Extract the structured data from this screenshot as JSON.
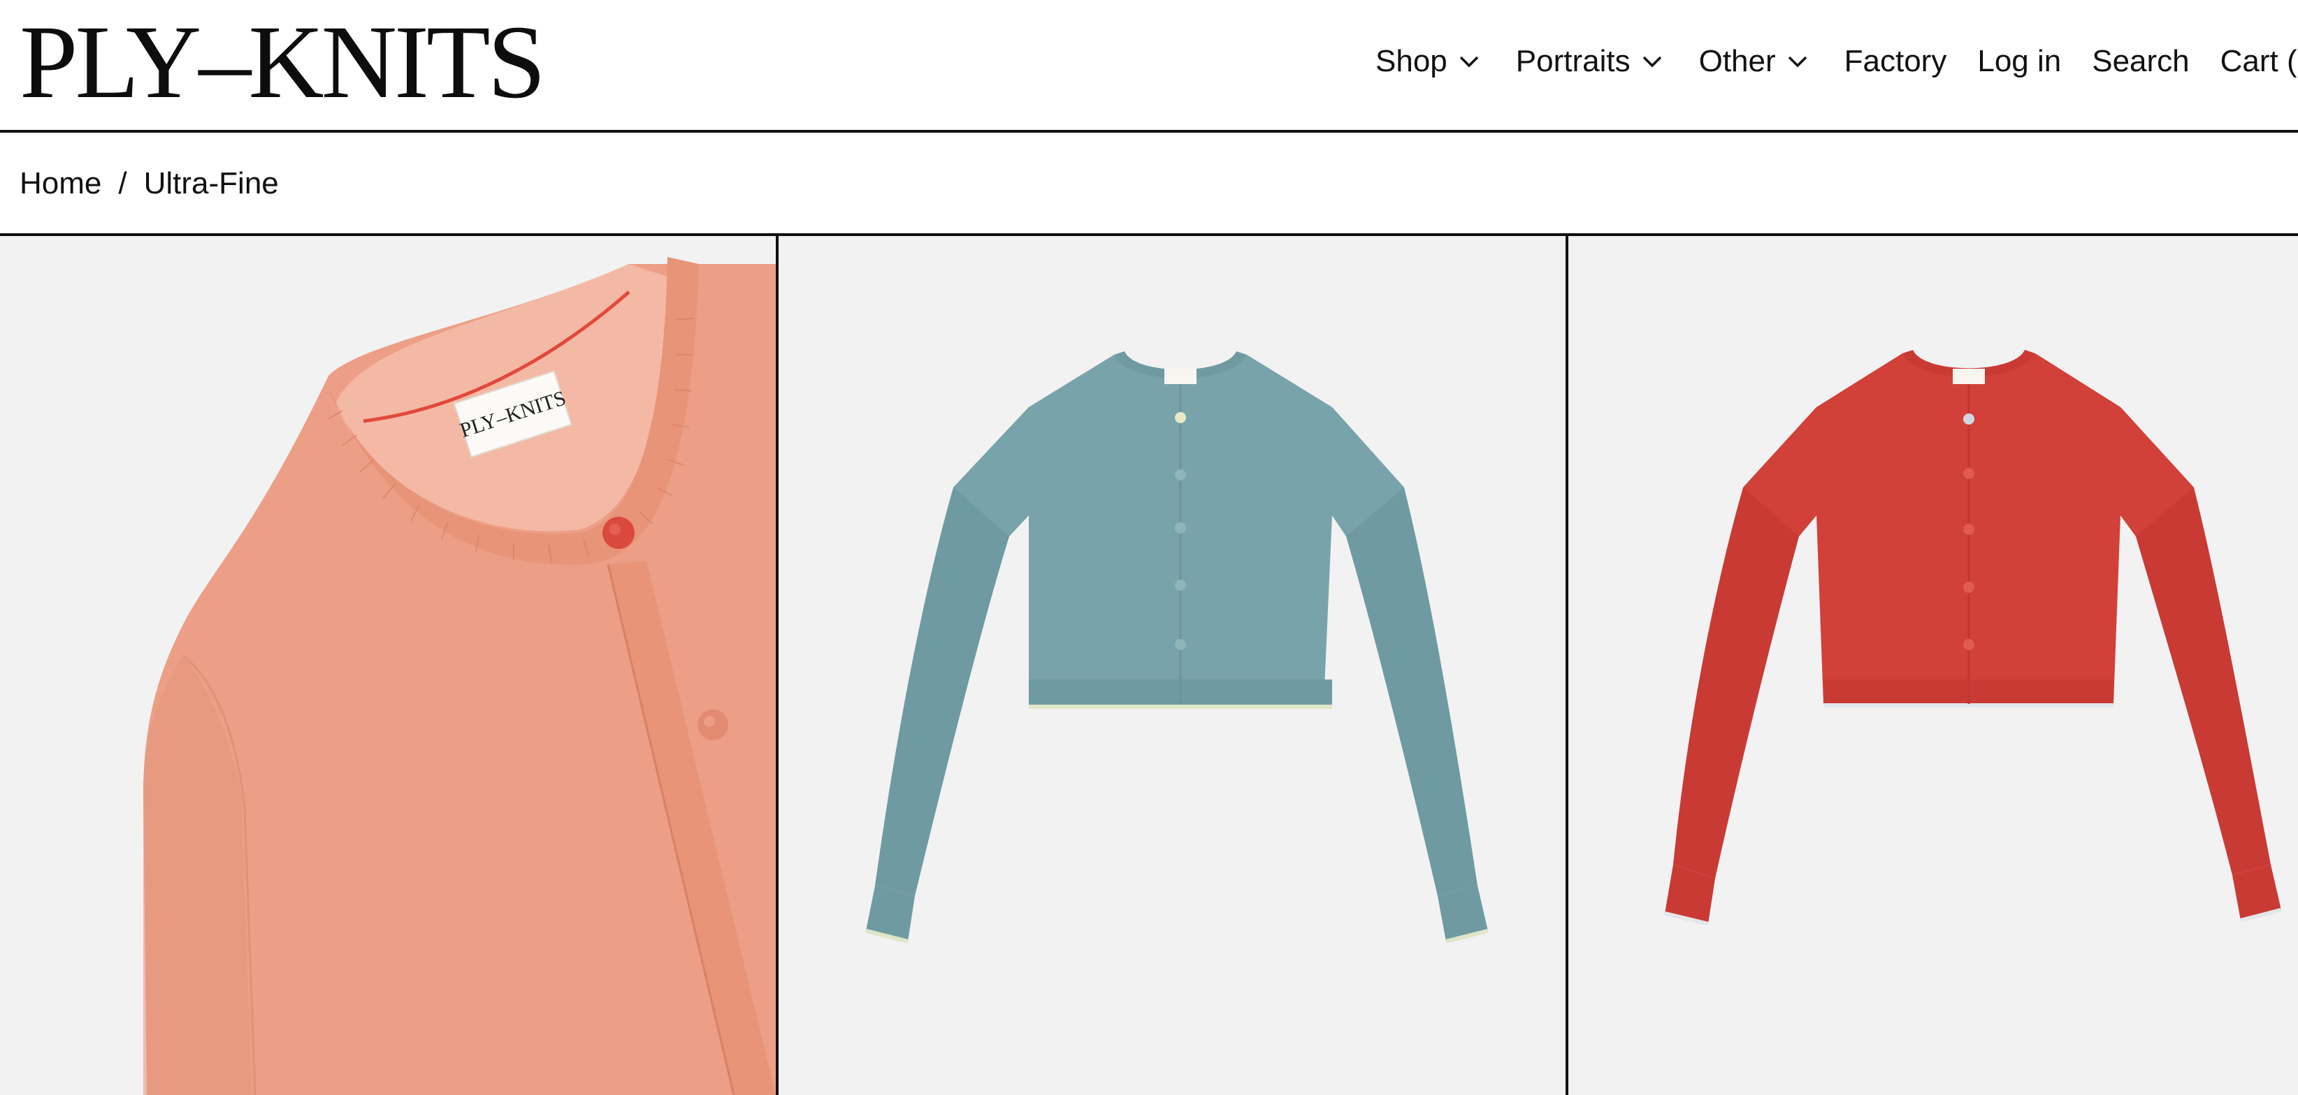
{
  "header": {
    "logo": "PLY–KNITS",
    "nav": [
      {
        "label": "Shop",
        "dropdown": true
      },
      {
        "label": "Portraits",
        "dropdown": true
      },
      {
        "label": "Other",
        "dropdown": true
      },
      {
        "label": "Factory",
        "dropdown": false
      },
      {
        "label": "Log in",
        "dropdown": false
      },
      {
        "label": "Search",
        "dropdown": false
      },
      {
        "label": "Cart (",
        "dropdown": false
      }
    ]
  },
  "breadcrumb": {
    "home": "Home",
    "separator": "/",
    "current": "Ultra-Fine"
  },
  "gallery": {
    "label_text": "PLY–KNITS",
    "products": [
      {
        "color_name": "peach",
        "color": "#ec9f86",
        "button_color": "#d94a3c",
        "view": "detail"
      },
      {
        "color_name": "blue",
        "color": "#79a3aa",
        "button_color": "#79a3aa",
        "view": "full"
      },
      {
        "color_name": "red",
        "color": "#d2403a",
        "button_color": "#d2403a",
        "view": "full"
      }
    ]
  },
  "colors": {
    "border": "#111111",
    "background": "#f2f2f2"
  }
}
